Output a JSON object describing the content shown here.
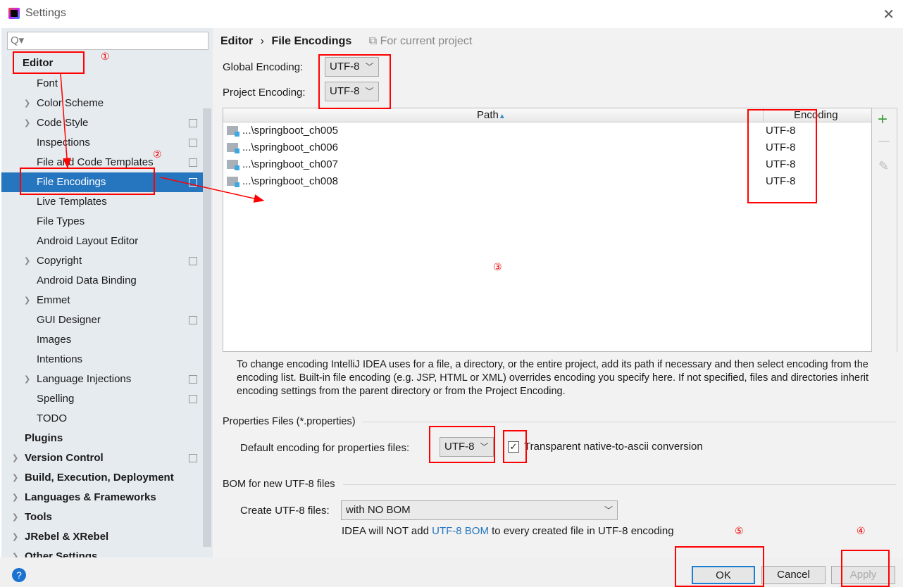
{
  "window": {
    "title": "Settings",
    "close": "✕"
  },
  "search": {
    "icon": "search-icon",
    "glyph": "Q▾",
    "placeholder": ""
  },
  "sidebar": {
    "items": [
      {
        "label": "Editor",
        "level": 0,
        "bold": true,
        "expand": false,
        "copy": false
      },
      {
        "label": "Font",
        "level": 1
      },
      {
        "label": "Color Scheme",
        "level": 1,
        "expand": true
      },
      {
        "label": "Code Style",
        "level": 1,
        "expand": true,
        "copy": true
      },
      {
        "label": "Inspections",
        "level": 1,
        "copy": true
      },
      {
        "label": "File and Code Templates",
        "level": 1,
        "copy": true
      },
      {
        "label": "File Encodings",
        "level": 1,
        "copy": true,
        "selected": true
      },
      {
        "label": "Live Templates",
        "level": 1
      },
      {
        "label": "File Types",
        "level": 1
      },
      {
        "label": "Android Layout Editor",
        "level": 1
      },
      {
        "label": "Copyright",
        "level": 1,
        "expand": true,
        "copy": true
      },
      {
        "label": "Android Data Binding",
        "level": 1
      },
      {
        "label": "Emmet",
        "level": 1,
        "expand": true
      },
      {
        "label": "GUI Designer",
        "level": 1,
        "copy": true
      },
      {
        "label": "Images",
        "level": 1
      },
      {
        "label": "Intentions",
        "level": 1
      },
      {
        "label": "Language Injections",
        "level": 1,
        "expand": true,
        "copy": true
      },
      {
        "label": "Spelling",
        "level": 1,
        "copy": true
      },
      {
        "label": "TODO",
        "level": 1
      },
      {
        "label": "Plugins",
        "level": 0,
        "bold": true
      },
      {
        "label": "Version Control",
        "level": 0,
        "bold": true,
        "expand": true,
        "copy": true
      },
      {
        "label": "Build, Execution, Deployment",
        "level": 0,
        "bold": true,
        "expand": true
      },
      {
        "label": "Languages & Frameworks",
        "level": 0,
        "bold": true,
        "expand": true
      },
      {
        "label": "Tools",
        "level": 0,
        "bold": true,
        "expand": true
      },
      {
        "label": "JRebel & XRebel",
        "level": 0,
        "bold": true,
        "expand": true
      },
      {
        "label": "Other Settings",
        "level": 0,
        "bold": true,
        "expand": true
      }
    ]
  },
  "breadcrumb": {
    "parent": "Editor",
    "sep": "›",
    "current": "File Encodings",
    "scope": "For current project"
  },
  "global_encoding": {
    "label": "Global Encoding:",
    "value": "UTF-8"
  },
  "project_encoding": {
    "label": "Project Encoding:",
    "value": "UTF-8"
  },
  "table": {
    "columns": [
      "Path",
      "Encoding"
    ],
    "sort_icon": "▲",
    "rows": [
      {
        "path": "...\\springboot_ch005",
        "encoding": "UTF-8"
      },
      {
        "path": "...\\springboot_ch006",
        "encoding": "UTF-8"
      },
      {
        "path": "...\\springboot_ch007",
        "encoding": "UTF-8"
      },
      {
        "path": "...\\springboot_ch008",
        "encoding": "UTF-8"
      }
    ],
    "add": "+",
    "remove": "—",
    "edit": "✎"
  },
  "help_text": "To change encoding IntelliJ IDEA uses for a file, a directory, or the entire project, add its path if necessary and then select encoding from the encoding list. Built-in file encoding (e.g. JSP, HTML or XML) overrides encoding you specify here. If not specified, files and directories inherit encoding settings from the parent directory or from the Project Encoding.",
  "properties": {
    "section": "Properties Files (*.properties)",
    "label": "Default encoding for properties files:",
    "value": "UTF-8",
    "checkbox_label": "Transparent native-to-ascii conversion",
    "checked": true
  },
  "bom": {
    "section": "BOM for new UTF-8 files",
    "label": "Create UTF-8 files:",
    "value": "with NO BOM",
    "note_pre": "IDEA will NOT add ",
    "note_link": "UTF-8 BOM",
    "note_post": " to every created file in UTF-8 encoding"
  },
  "buttons": {
    "ok": "OK",
    "cancel": "Cancel",
    "apply": "Apply",
    "help": "?"
  },
  "annotations": [
    "①",
    "②",
    "③",
    "④",
    "⑤"
  ],
  "colors": {
    "selection": "#2675bf",
    "annotation": "#ff0000",
    "link": "#2675bf"
  }
}
